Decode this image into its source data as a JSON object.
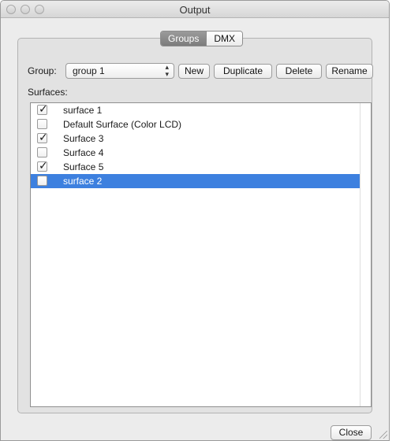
{
  "window": {
    "title": "Output"
  },
  "tabs": [
    {
      "label": "Groups",
      "active": true
    },
    {
      "label": "DMX",
      "active": false
    }
  ],
  "group": {
    "label": "Group:",
    "selected": "group 1"
  },
  "buttons": {
    "new": "New",
    "duplicate": "Duplicate",
    "delete": "Delete",
    "rename": "Rename",
    "close": "Close"
  },
  "surfaces": {
    "label": "Surfaces:",
    "items": [
      {
        "label": "surface 1",
        "checked": true,
        "selected": false
      },
      {
        "label": "Default Surface (Color LCD)",
        "checked": false,
        "selected": false
      },
      {
        "label": "Surface 3",
        "checked": true,
        "selected": false
      },
      {
        "label": "Surface 4",
        "checked": false,
        "selected": false
      },
      {
        "label": "Surface 5",
        "checked": true,
        "selected": false
      },
      {
        "label": "surface 2",
        "checked": false,
        "selected": true
      }
    ]
  },
  "colors": {
    "selection": "#3d80df",
    "window_bg": "#ececec"
  }
}
